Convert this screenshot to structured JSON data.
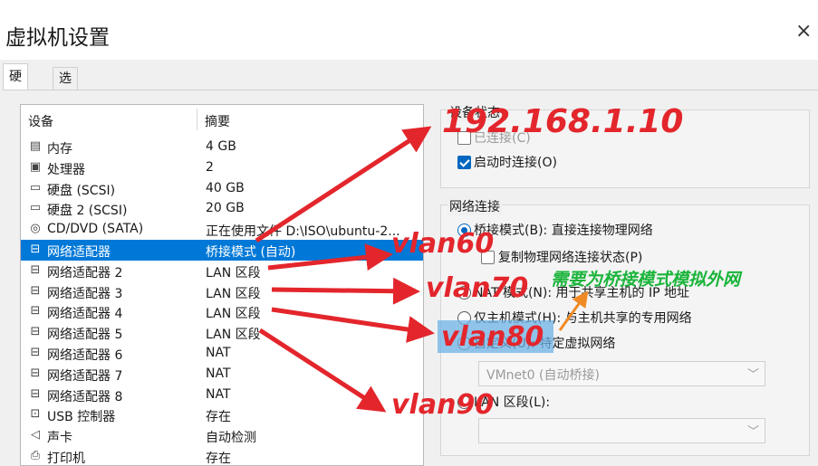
{
  "window": {
    "title": "虚拟机设置",
    "close_glyph": "×"
  },
  "tabs": [
    {
      "label": "硬件"
    },
    {
      "label": "选项"
    }
  ],
  "device_list": {
    "header_device": "设备",
    "header_summary": "摘要",
    "rows": [
      {
        "icon": "memory-icon",
        "glyph": "▤",
        "name": "内存",
        "summary": "4 GB"
      },
      {
        "icon": "cpu-icon",
        "glyph": "▣",
        "name": "处理器",
        "summary": "2"
      },
      {
        "icon": "disk-icon",
        "glyph": "▭",
        "name": "硬盘 (SCSI)",
        "summary": "40 GB"
      },
      {
        "icon": "disk-icon",
        "glyph": "▭",
        "name": "硬盘 2 (SCSI)",
        "summary": "20 GB"
      },
      {
        "icon": "cd-icon",
        "glyph": "◎",
        "name": "CD/DVD (SATA)",
        "summary": "正在使用文件 D:\\ISO\\ubuntu-2..."
      },
      {
        "icon": "network-icon",
        "glyph": "⊟",
        "name": "网络适配器",
        "summary": "桥接模式 (自动)",
        "selected": true
      },
      {
        "icon": "network-icon",
        "glyph": "⊟",
        "name": "网络适配器 2",
        "summary": "LAN 区段"
      },
      {
        "icon": "network-icon",
        "glyph": "⊟",
        "name": "网络适配器 3",
        "summary": "LAN 区段"
      },
      {
        "icon": "network-icon",
        "glyph": "⊟",
        "name": "网络适配器 4",
        "summary": "LAN 区段"
      },
      {
        "icon": "network-icon",
        "glyph": "⊟",
        "name": "网络适配器 5",
        "summary": "LAN 区段"
      },
      {
        "icon": "network-icon",
        "glyph": "⊟",
        "name": "网络适配器 6",
        "summary": "NAT"
      },
      {
        "icon": "network-icon",
        "glyph": "⊟",
        "name": "网络适配器 7",
        "summary": "NAT"
      },
      {
        "icon": "network-icon",
        "glyph": "⊟",
        "name": "网络适配器 8",
        "summary": "NAT"
      },
      {
        "icon": "usb-icon",
        "glyph": "⊡",
        "name": "USB 控制器",
        "summary": "存在"
      },
      {
        "icon": "sound-icon",
        "glyph": "◁",
        "name": "声卡",
        "summary": "自动检测"
      },
      {
        "icon": "printer-icon",
        "glyph": "⎙",
        "name": "打印机",
        "summary": "存在"
      }
    ]
  },
  "device_status": {
    "label": "设备状态",
    "connected": {
      "label": "已连接(C)",
      "checked": false,
      "enabled": false
    },
    "connect_on_start": {
      "label": "启动时连接(O)",
      "checked": true
    }
  },
  "network_connection": {
    "label": "网络连接",
    "bridged": {
      "label": "桥接模式(B): 直接连接物理网络",
      "selected": true
    },
    "replicate": {
      "label": "复制物理网络连接状态(P)",
      "checked": false
    },
    "nat": {
      "label": "NAT 模式(N): 用于共享主机的 IP 地址",
      "selected": false
    },
    "host_only": {
      "label": "仅主机模式(H): 与主机共享的专用网络",
      "selected": false
    },
    "custom": {
      "label": "自定义(U): 特定虚拟网络",
      "selected": false
    },
    "custom_select_value": "VMnet0 (自动桥接)",
    "lan_segment": {
      "label": "LAN 区段(L):",
      "selected": false
    },
    "lan_select_value": ""
  },
  "annotations": {
    "ip": "192.168.1.10",
    "vlan60": "vlan60",
    "vlan70": "vlan70",
    "vlan80": "vlan80",
    "vlan90": "vlan90",
    "note": "需要为桥接模式模拟外网"
  },
  "colors": {
    "annotation_red": "#e3262c",
    "annotation_green": "#1ab43a",
    "selection": "#0078d7",
    "accent": "#0067c0"
  }
}
